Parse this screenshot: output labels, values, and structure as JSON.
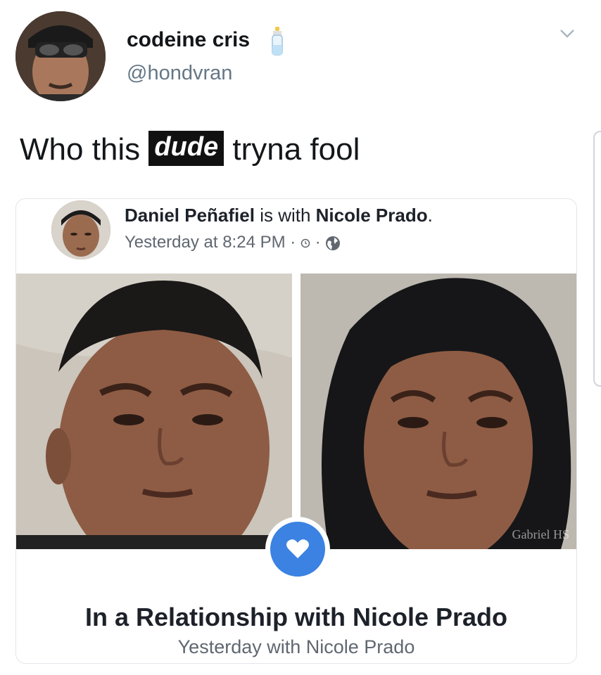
{
  "tweet": {
    "display_name": "codeine cris",
    "handle": "@hondvran",
    "text_before": "Who this ",
    "text_highlight": "dude",
    "text_after": " tryna fool",
    "menu_icon": "chevron-down-icon",
    "name_emoji": "baby-bottle-icon"
  },
  "facebook_post": {
    "author": "Daniel Peñafiel",
    "with_text": " is with ",
    "tagged": "Nicole Prado",
    "period": ".",
    "timestamp": "Yesterday at 8:24 PM",
    "separator": " · ",
    "privacy_icon": "globe-icon",
    "watermark": "Gabriel HS",
    "relationship_title": "In a Relationship with Nicole Prado",
    "relationship_sub": "Yesterday with Nicole Prado",
    "badge_icon": "heart-icon",
    "badge_color": "#3b82e2"
  }
}
